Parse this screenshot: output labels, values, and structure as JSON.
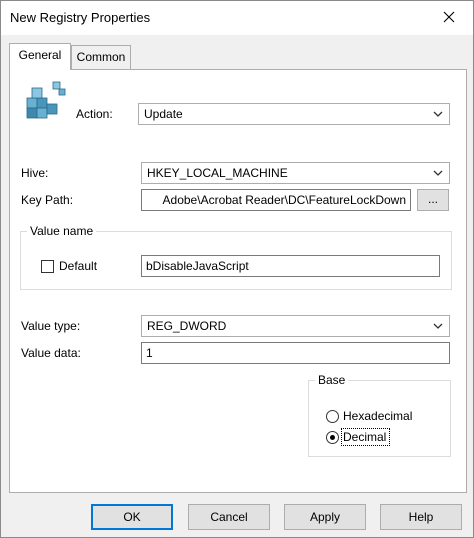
{
  "window": {
    "title": "New Registry Properties"
  },
  "tabs": [
    {
      "label": "General",
      "active": true
    },
    {
      "label": "Common",
      "active": false
    }
  ],
  "action": {
    "label": "Action:",
    "value": "Update"
  },
  "hive": {
    "label": "Hive:",
    "value": "HKEY_LOCAL_MACHINE"
  },
  "key_path": {
    "label": "Key Path:",
    "value": "Adobe\\Acrobat Reader\\DC\\FeatureLockDown",
    "browse_label": "..."
  },
  "value_name": {
    "group_label": "Value name",
    "default_label": "Default",
    "default_checked": false,
    "value": "bDisableJavaScript"
  },
  "value_type": {
    "label": "Value type:",
    "value": "REG_DWORD"
  },
  "value_data": {
    "label": "Value data:",
    "value": "1"
  },
  "base": {
    "group_label": "Base",
    "options": [
      {
        "label": "Hexadecimal",
        "selected": false
      },
      {
        "label": "Decimal",
        "selected": true
      }
    ]
  },
  "buttons": {
    "ok": "OK",
    "cancel": "Cancel",
    "apply": "Apply",
    "help": "Help"
  },
  "icons": {
    "close": "close-icon",
    "registry": "registry-cubes-icon",
    "dropdown": "chevron-down-icon"
  }
}
